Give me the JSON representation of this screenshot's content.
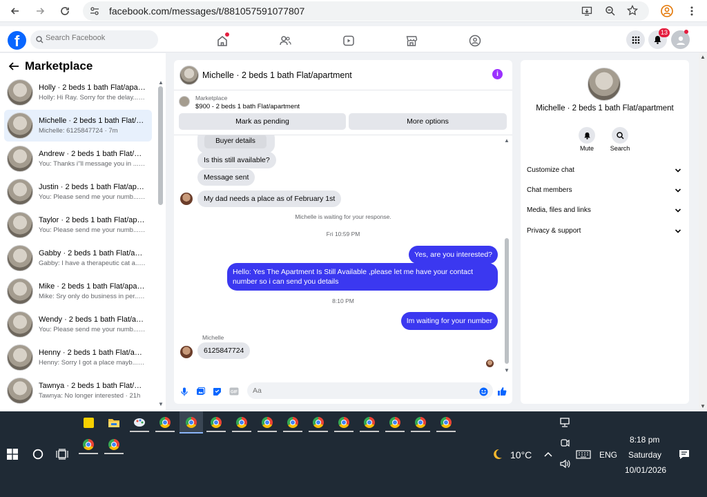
{
  "browser": {
    "url": "facebook.com/messages/t/881057591077807"
  },
  "fb_nav": {
    "search_placeholder": "Search Facebook",
    "notification_count": "13"
  },
  "sidebar": {
    "title": "Marketplace",
    "conversations": [
      {
        "title": "Holly · 2 beds 1 bath Flat/apart...",
        "preview": "Holly: Hi Ray. Sorry for the delay.... · 5m"
      },
      {
        "title": "Michelle · 2 beds 1 bath Flat/ap...",
        "preview": "Michelle: 6125847724 · 7m"
      },
      {
        "title": "Andrew · 2 beds 1 bath Flat/ap...",
        "preview": "You: Thanks i''ll message you in ... · 18m"
      },
      {
        "title": "Justin · 2 beds 1 bath Flat/apart...",
        "preview": "You: Please send me your numb... · 18h"
      },
      {
        "title": "Taylor · 2 beds 1 bath Flat/apar...",
        "preview": "You: Please send me your numb... · 18h"
      },
      {
        "title": "Gabby · 2 beds 1 bath Flat/apar...",
        "preview": "Gabby: I have a therapeutic cat a... · 20h"
      },
      {
        "title": "Mike · 2 beds 1 bath Flat/apart...",
        "preview": "Mike: Sry only do business in per... · 20h"
      },
      {
        "title": "Wendy · 2 beds 1 bath Flat/apa...",
        "preview": "You: Please send me your numb... · 20h"
      },
      {
        "title": "Henny · 2 beds 1 bath Flat/apart...",
        "preview": "Henny: Sorry I got a place mayb... · 20h"
      },
      {
        "title": "Tawnya · 2 beds 1 bath Flat/apa...",
        "preview": "Tawnya: No longer interested · 21h"
      }
    ]
  },
  "chat": {
    "title": "Michelle · 2 beds 1 bath Flat/apartment",
    "listing_label": "Marketplace",
    "listing_price": "$900 - 2 beds 1 bath Flat/apartment",
    "mark_pending": "Mark as pending",
    "more_options": "More options",
    "buyer_details": "Buyer details",
    "messages": {
      "m1": "Is this still available?",
      "m2": "Message sent",
      "m3": "My dad needs a place as of February 1st",
      "sys1": "Michelle is waiting for your response.",
      "time1": "Fri 10:59 PM",
      "out1": "Yes, are you interested?",
      "out2": "Hello: Yes The Apartment Is Still Available ,please let me have your contact number so i can send you details",
      "time2": "8:10 PM",
      "out3": "Im waiting for your number",
      "sender": "Michelle",
      "m4": "6125847724"
    },
    "input_placeholder": "Aa"
  },
  "details": {
    "title": "Michelle · 2 beds 1 bath Flat/apartment",
    "mute": "Mute",
    "search": "Search",
    "sections": [
      "Customize chat",
      "Chat members",
      "Media, files and links",
      "Privacy & support"
    ]
  },
  "taskbar": {
    "weather": "10°C",
    "lang": "ENG",
    "time": "8:18 pm",
    "day": "Saturday",
    "date": "10/01/2026"
  }
}
